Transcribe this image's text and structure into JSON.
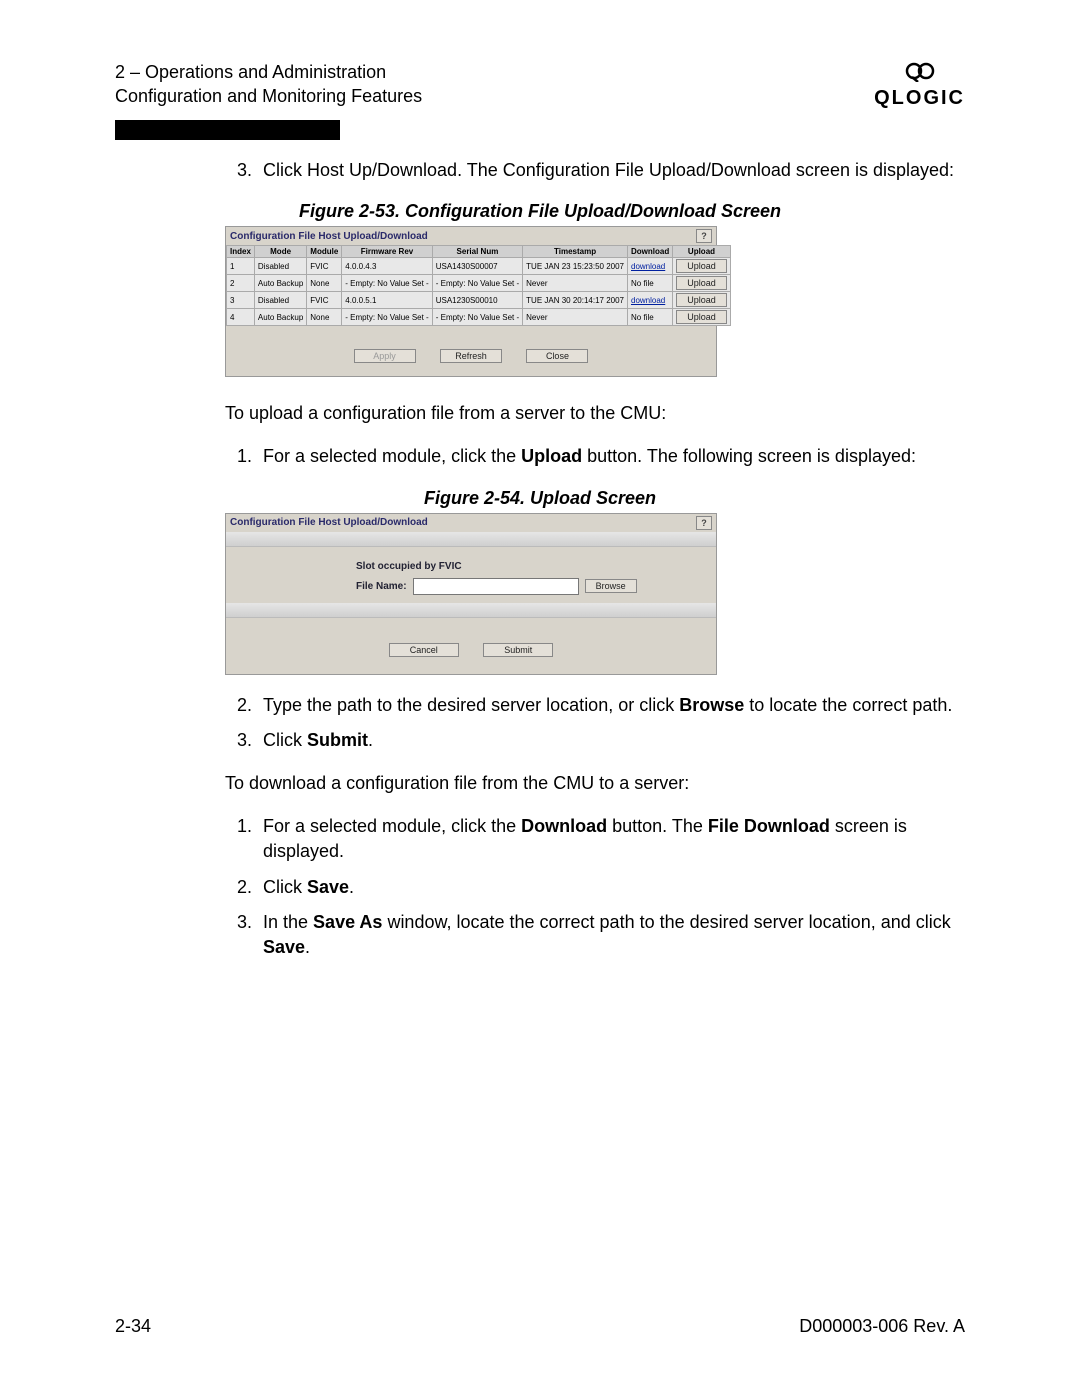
{
  "header": {
    "line1": "2 – Operations and Administration",
    "line2": "Configuration and Monitoring Features",
    "brand": "QLOGIC"
  },
  "para_top": "Click Host Up/Download. The Configuration File Upload/Download screen is displayed:",
  "fig53": {
    "caption": "Figure 2-53. Configuration File Upload/Download Screen",
    "title": "Configuration File Host Upload/Download",
    "help": "?",
    "cols": [
      "Index",
      "Mode",
      "Module",
      "Firmware Rev",
      "Serial Num",
      "Timestamp",
      "Download",
      "Upload"
    ],
    "rows": [
      {
        "index": "1",
        "mode": "Disabled",
        "module": "FVIC",
        "fw": "4.0.0.4.3",
        "sn": "USA1430S00007",
        "ts": "TUE JAN 23 15:23:50 2007",
        "dl": "download",
        "ul": "Upload"
      },
      {
        "index": "2",
        "mode": "Auto Backup",
        "module": "None",
        "fw": "- Empty: No Value Set -",
        "sn": "- Empty: No Value Set -",
        "ts": "Never",
        "dl": "No file",
        "ul": "Upload"
      },
      {
        "index": "3",
        "mode": "Disabled",
        "module": "FVIC",
        "fw": "4.0.0.5.1",
        "sn": "USA1230S00010",
        "ts": "TUE JAN 30 20:14:17 2007",
        "dl": "download",
        "ul": "Upload"
      },
      {
        "index": "4",
        "mode": "Auto Backup",
        "module": "None",
        "fw": "- Empty: No Value Set -",
        "sn": "- Empty: No Value Set -",
        "ts": "Never",
        "dl": "No file",
        "ul": "Upload"
      }
    ],
    "btn_apply": "Apply",
    "btn_refresh": "Refresh",
    "btn_close": "Close"
  },
  "para_mid": "To upload a configuration file from a server to the CMU:",
  "upload_step1_a": "For a selected module, click the ",
  "upload_step1_b": "Upload",
  "upload_step1_c": " button. The following screen is displayed:",
  "fig54": {
    "caption": "Figure 2-54. Upload Screen",
    "title": "Configuration File Host Upload/Download",
    "help": "?",
    "slot": "Slot occupied by FVIC",
    "file_label": "File Name:",
    "browse": "Browse",
    "cancel": "Cancel",
    "submit": "Submit"
  },
  "upload_step2_a": "Type the path to the desired server location, or click ",
  "upload_step2_b": "Browse",
  "upload_step2_c": " to locate the correct path.",
  "upload_step3_a": "Click ",
  "upload_step3_b": "Submit",
  "upload_step3_c": ".",
  "para_download": "To download a configuration file from the CMU to a server:",
  "dl_step1_a": "For a selected module, click the ",
  "dl_step1_b": "Download",
  "dl_step1_c": " button. The ",
  "dl_step1_d": "File Download",
  "dl_step1_e": " screen is displayed.",
  "dl_step2_a": "Click ",
  "dl_step2_b": "Save",
  "dl_step2_c": ".",
  "dl_step3_a": "In the ",
  "dl_step3_b": "Save As",
  "dl_step3_c": " window, locate the correct path to the desired server location, and click ",
  "dl_step3_d": "Save",
  "dl_step3_e": ".",
  "footer": {
    "left": "2-34",
    "right": "D000003-006 Rev. A"
  }
}
